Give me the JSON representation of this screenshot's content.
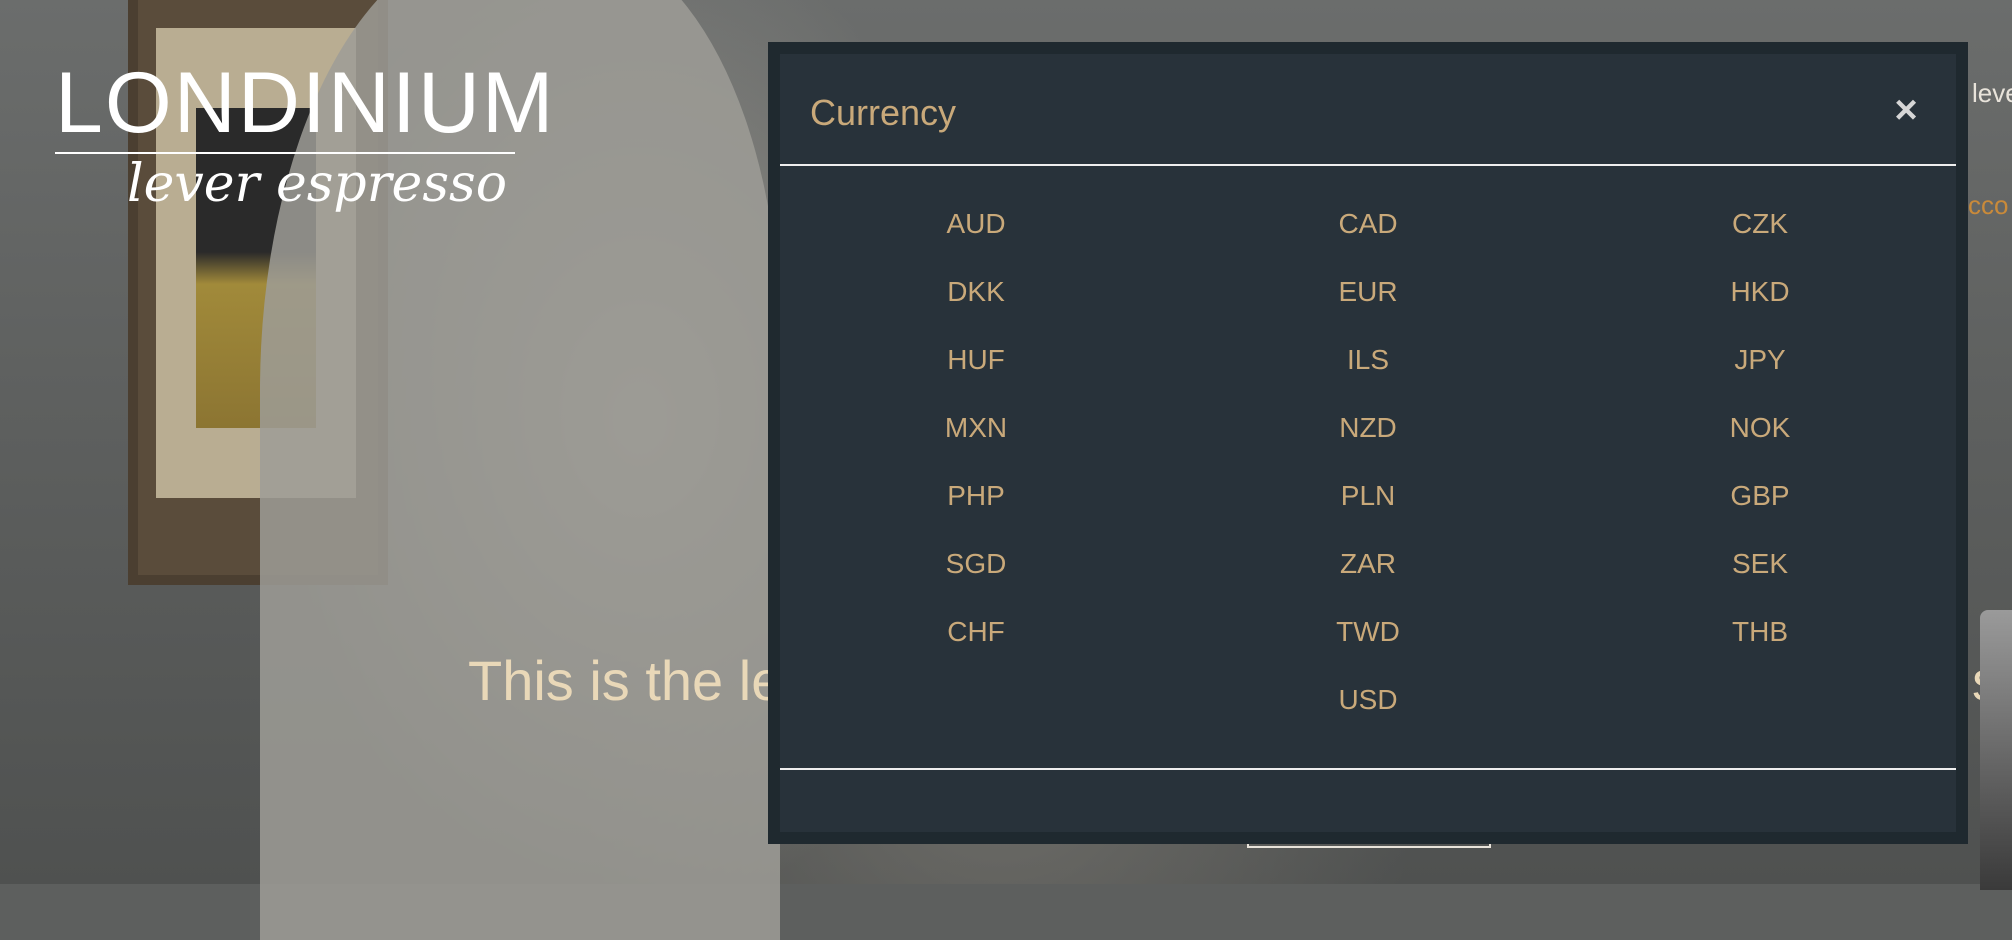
{
  "brand": {
    "logo_main": "LONDINIUM",
    "logo_script": "lever espresso"
  },
  "page": {
    "hero_text_start": "This is the le",
    "hero_text_end": "se",
    "corner_link_1": "leve",
    "corner_link_2": "cco"
  },
  "modal": {
    "title": "Currency",
    "close_label": "×",
    "currencies": [
      "AUD",
      "CAD",
      "CZK",
      "DKK",
      "EUR",
      "HKD",
      "HUF",
      "ILS",
      "JPY",
      "MXN",
      "NZD",
      "NOK",
      "PHP",
      "PLN",
      "GBP",
      "SGD",
      "ZAR",
      "SEK",
      "CHF",
      "TWD",
      "THB",
      "USD"
    ]
  },
  "colors": {
    "modal_bg": "#28323a",
    "accent_gold": "#c9a97a",
    "divider": "#eeeeee"
  }
}
